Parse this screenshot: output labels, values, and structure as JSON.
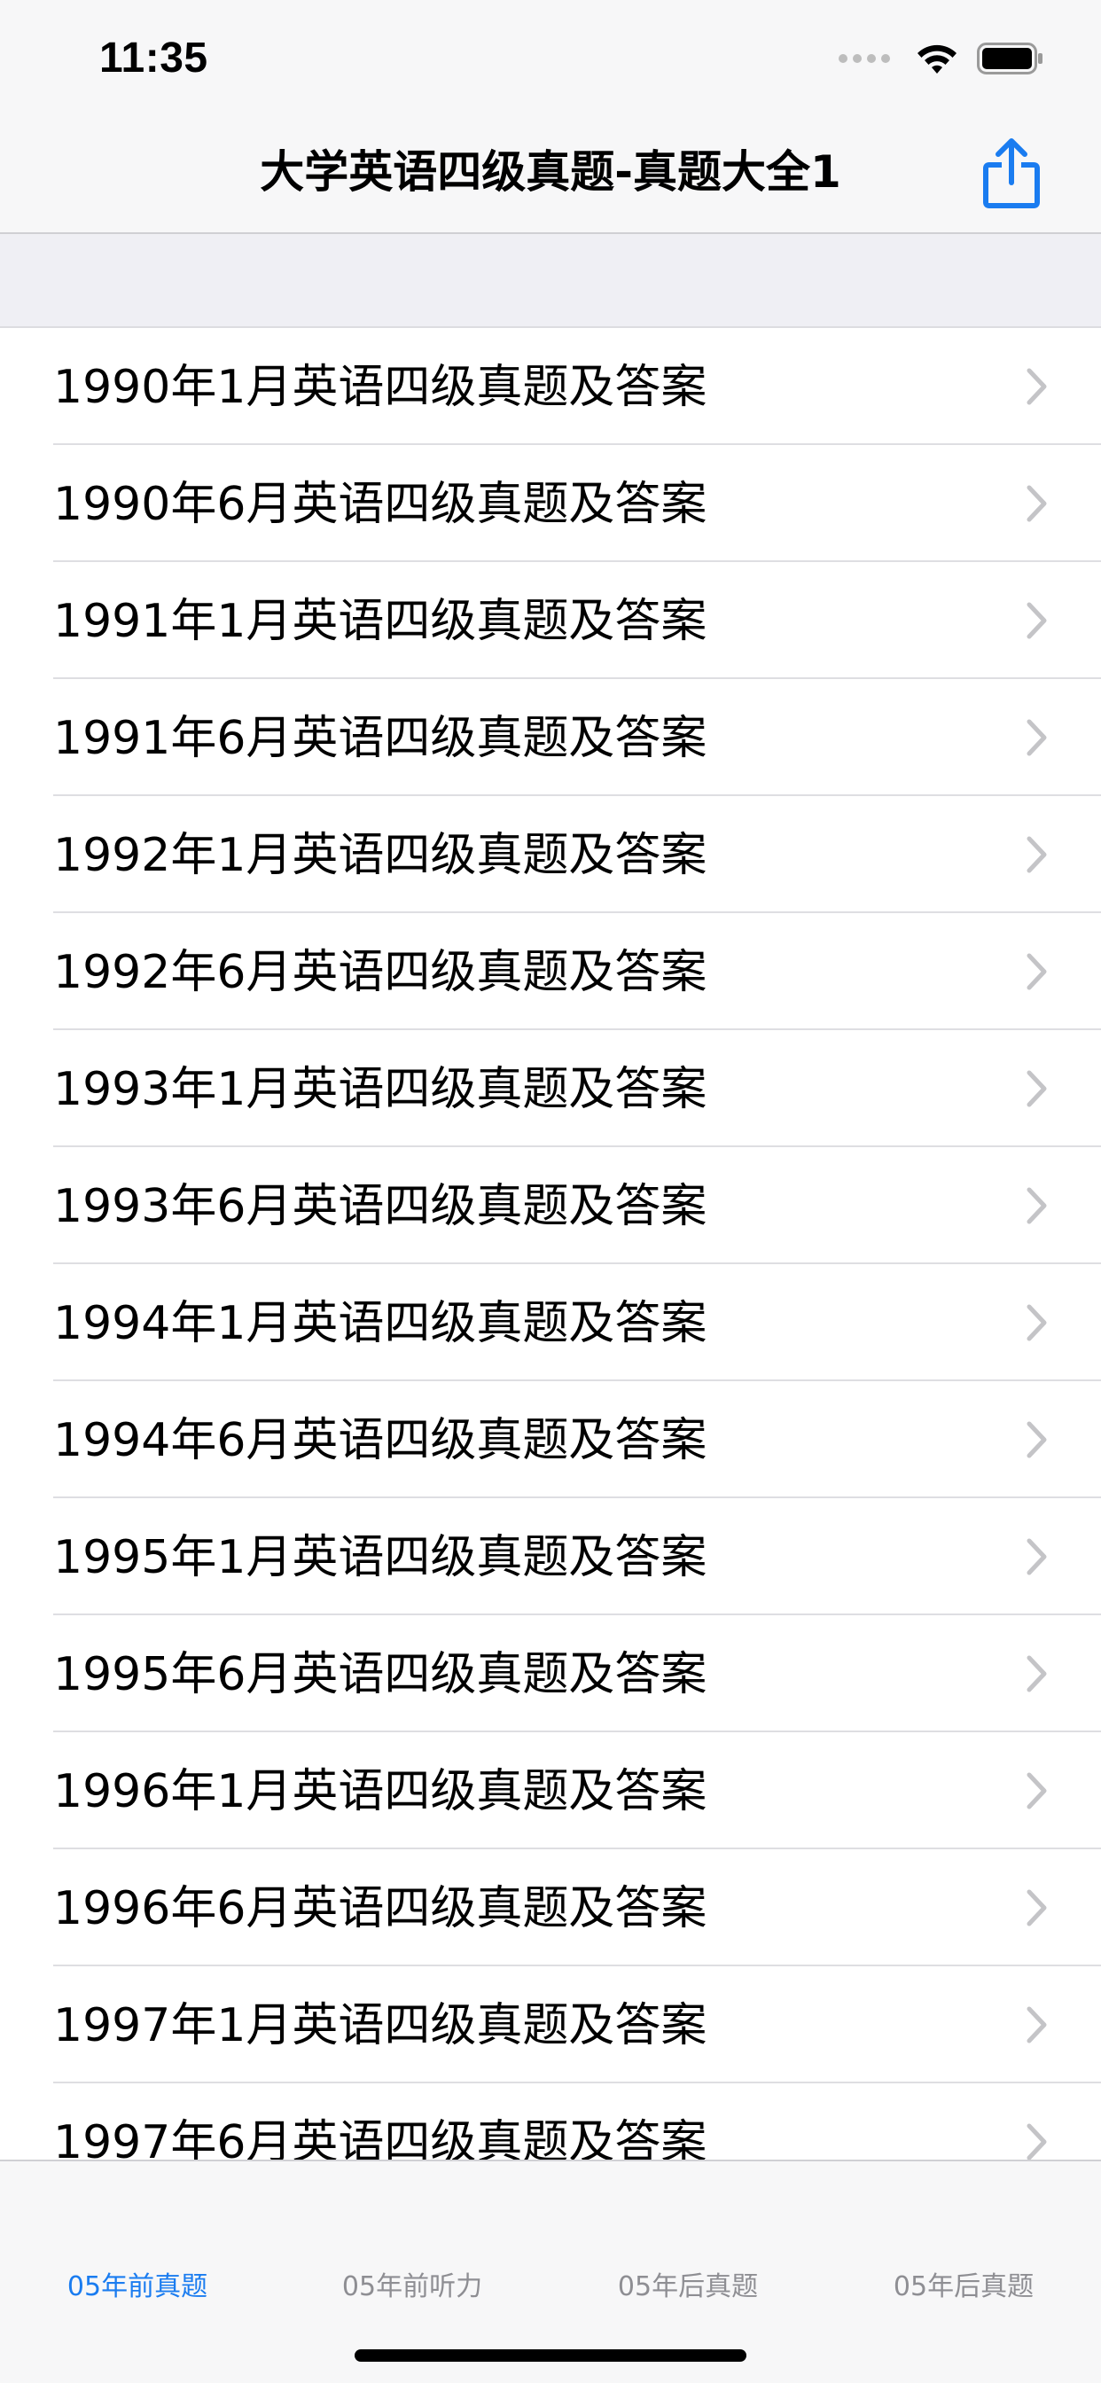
{
  "status_bar": {
    "time": "11:35"
  },
  "nav": {
    "title": "大学英语四级真题-真题大全1",
    "share_icon": "share-icon",
    "accent_color": "#1a7cf0"
  },
  "list": {
    "items": [
      {
        "label": "1990年1月英语四级真题及答案"
      },
      {
        "label": "1990年6月英语四级真题及答案"
      },
      {
        "label": "1991年1月英语四级真题及答案"
      },
      {
        "label": "1991年6月英语四级真题及答案"
      },
      {
        "label": "1992年1月英语四级真题及答案"
      },
      {
        "label": "1992年6月英语四级真题及答案"
      },
      {
        "label": "1993年1月英语四级真题及答案"
      },
      {
        "label": "1993年6月英语四级真题及答案"
      },
      {
        "label": "1994年1月英语四级真题及答案"
      },
      {
        "label": "1994年6月英语四级真题及答案"
      },
      {
        "label": "1995年1月英语四级真题及答案"
      },
      {
        "label": "1995年6月英语四级真题及答案"
      },
      {
        "label": "1996年1月英语四级真题及答案"
      },
      {
        "label": "1996年6月英语四级真题及答案"
      },
      {
        "label": "1997年1月英语四级真题及答案"
      },
      {
        "label": "1997年6月英语四级真题及答案"
      }
    ]
  },
  "tabbar": {
    "tabs": [
      {
        "label": "05年前真题",
        "active": true
      },
      {
        "label": "05年前听力",
        "active": false
      },
      {
        "label": "05年后真题",
        "active": false
      },
      {
        "label": "05年后真题",
        "active": false
      }
    ]
  }
}
